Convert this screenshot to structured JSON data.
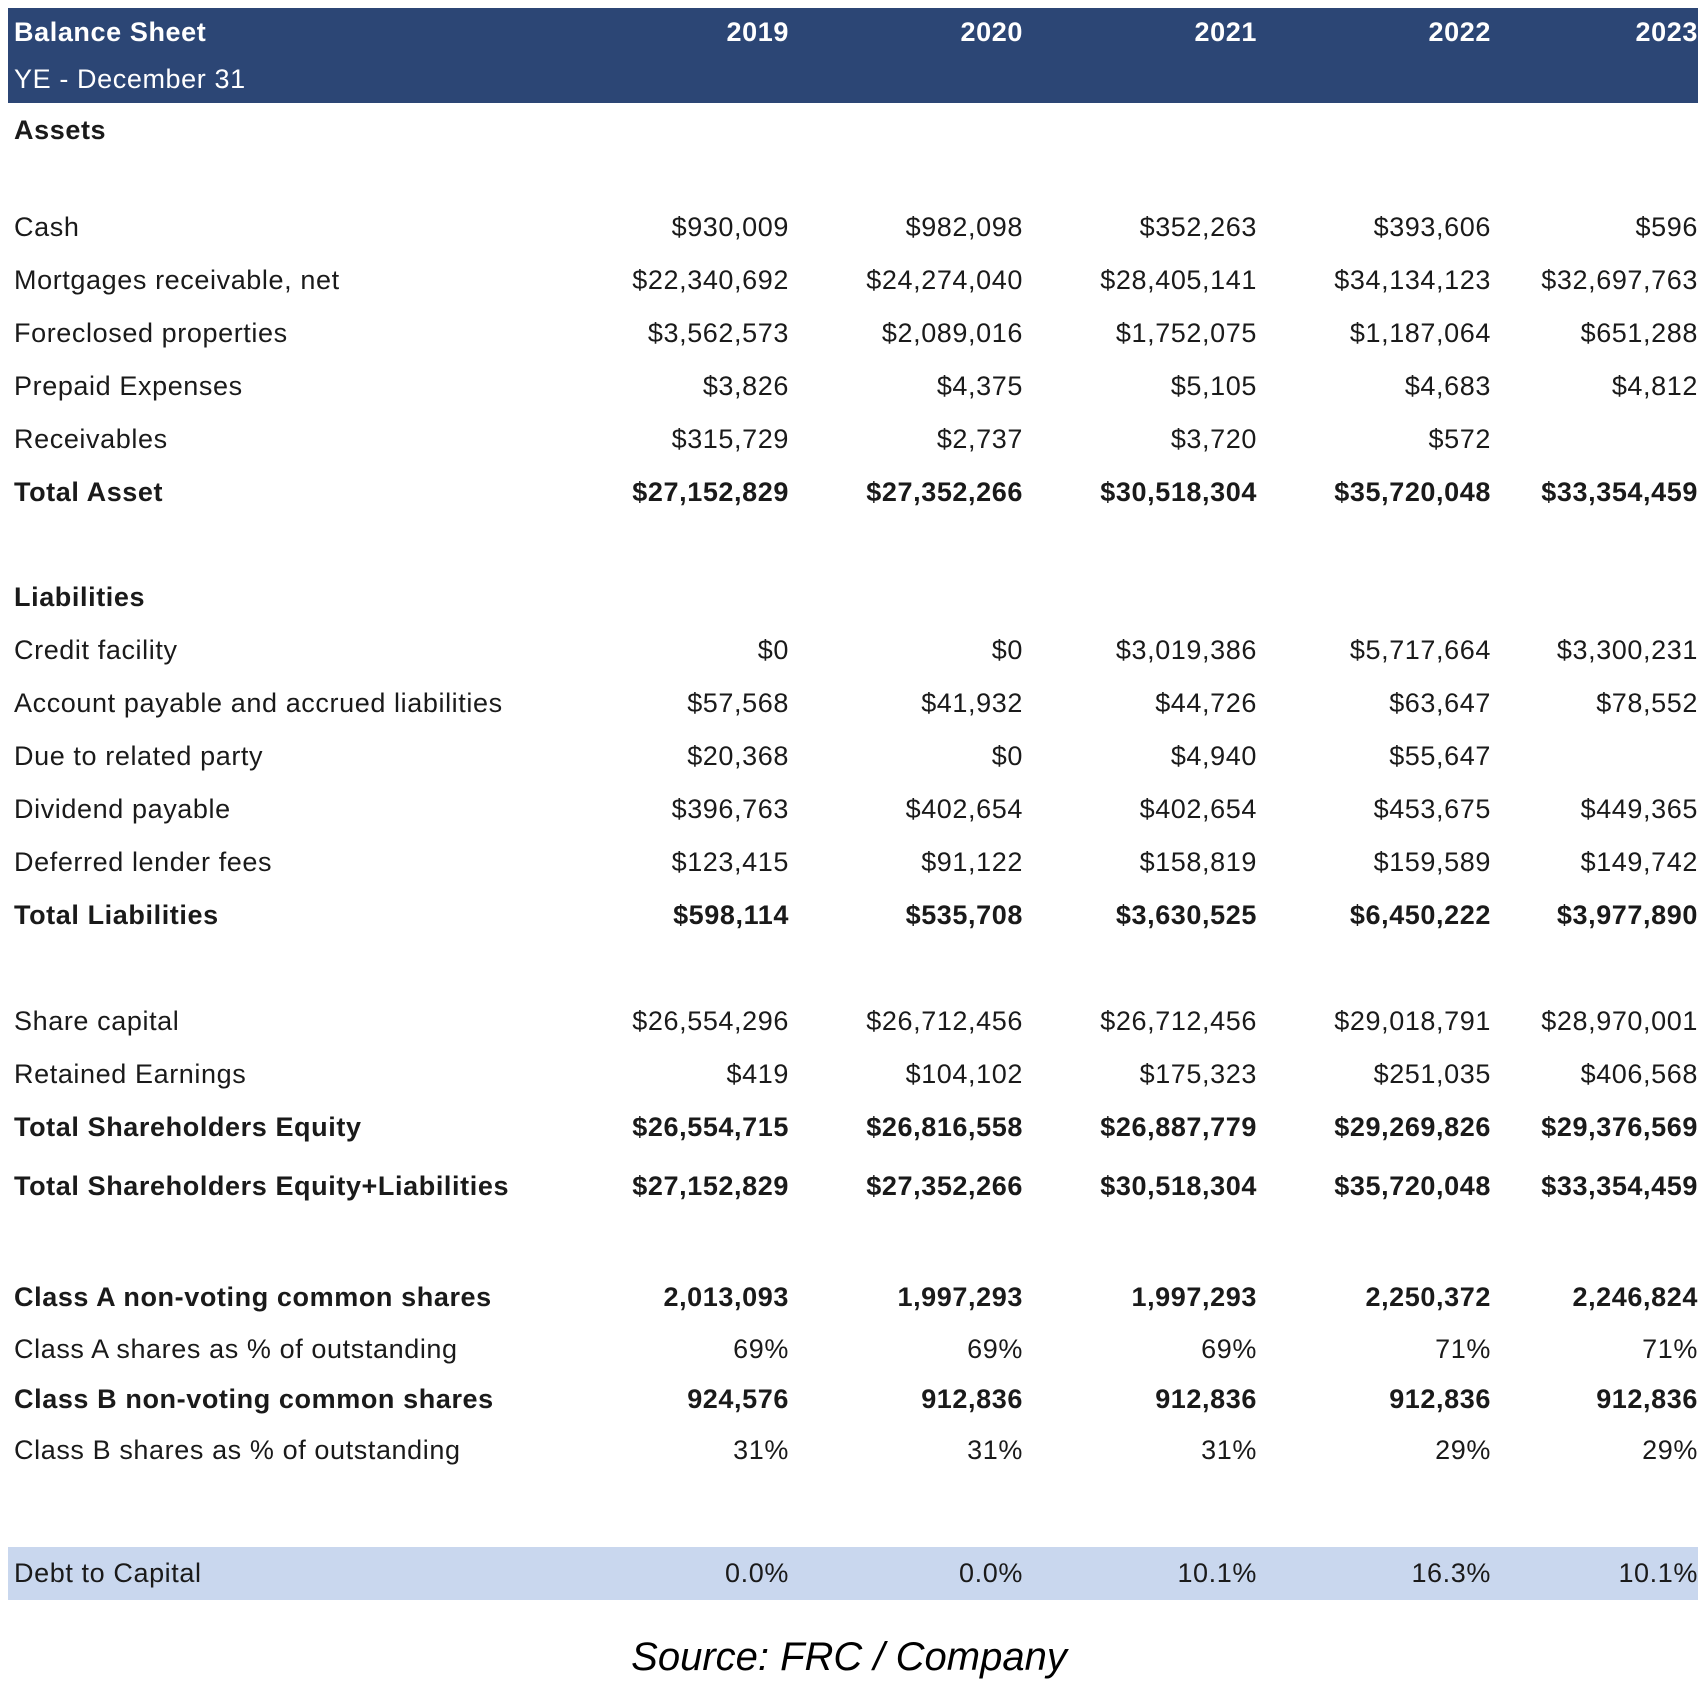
{
  "header": {
    "title": "Balance Sheet",
    "subtitle": "YE - December 31",
    "years": [
      "2019",
      "2020",
      "2021",
      "2022",
      "2023"
    ]
  },
  "colors": {
    "header_bg": "#2c4675",
    "header_text": "#ffffff",
    "highlight_bg": "#c9d7ee"
  },
  "sections": {
    "assets": {
      "heading": "Assets",
      "rows": [
        {
          "label": "Cash",
          "values": [
            "$930,009",
            "$982,098",
            "$352,263",
            "$393,606",
            "$596"
          ]
        },
        {
          "label": "Mortgages receivable, net",
          "values": [
            "$22,340,692",
            "$24,274,040",
            "$28,405,141",
            "$34,134,123",
            "$32,697,763"
          ]
        },
        {
          "label": "Foreclosed properties",
          "values": [
            "$3,562,573",
            "$2,089,016",
            "$1,752,075",
            "$1,187,064",
            "$651,288"
          ]
        },
        {
          "label": "Prepaid Expenses",
          "values": [
            "$3,826",
            "$4,375",
            "$5,105",
            "$4,683",
            "$4,812"
          ]
        },
        {
          "label": "Receivables",
          "values": [
            "$315,729",
            "$2,737",
            "$3,720",
            "$572",
            ""
          ]
        }
      ],
      "total": {
        "label": "Total Asset",
        "values": [
          "$27,152,829",
          "$27,352,266",
          "$30,518,304",
          "$35,720,048",
          "$33,354,459"
        ]
      }
    },
    "liabilities": {
      "heading": "Liabilities",
      "rows": [
        {
          "label": "Credit facility",
          "values": [
            "$0",
            "$0",
            "$3,019,386",
            "$5,717,664",
            "$3,300,231"
          ]
        },
        {
          "label": "Account payable and accrued liabilities",
          "values": [
            "$57,568",
            "$41,932",
            "$44,726",
            "$63,647",
            "$78,552"
          ]
        },
        {
          "label": "Due to related party",
          "values": [
            "$20,368",
            "$0",
            "$4,940",
            "$55,647",
            ""
          ]
        },
        {
          "label": "Dividend payable",
          "values": [
            "$396,763",
            "$402,654",
            "$402,654",
            "$453,675",
            "$449,365"
          ]
        },
        {
          "label": "Deferred lender fees",
          "values": [
            "$123,415",
            "$91,122",
            "$158,819",
            "$159,589",
            "$149,742"
          ]
        }
      ],
      "total": {
        "label": "Total Liabilities",
        "values": [
          "$598,114",
          "$535,708",
          "$3,630,525",
          "$6,450,222",
          "$3,977,890"
        ]
      }
    },
    "equity": {
      "rows": [
        {
          "label": "Share capital",
          "values": [
            "$26,554,296",
            "$26,712,456",
            "$26,712,456",
            "$29,018,791",
            "$28,970,001"
          ]
        },
        {
          "label": "Retained Earnings",
          "values": [
            "$419",
            "$104,102",
            "$175,323",
            "$251,035",
            "$406,568"
          ]
        }
      ],
      "total": {
        "label": "Total Shareholders Equity",
        "values": [
          "$26,554,715",
          "$26,816,558",
          "$26,887,779",
          "$29,269,826",
          "$29,376,569"
        ]
      },
      "grand_total": {
        "label": "Total Shareholders Equity+Liabilities",
        "values": [
          "$27,152,829",
          "$27,352,266",
          "$30,518,304",
          "$35,720,048",
          "$33,354,459"
        ]
      }
    },
    "shares": {
      "class_a": {
        "label": "Class A non-voting common shares",
        "values": [
          "2,013,093",
          "1,997,293",
          "1,997,293",
          "2,250,372",
          "2,246,824"
        ]
      },
      "class_a_pct": {
        "label": "Class A shares as % of outstanding",
        "values": [
          "69%",
          "69%",
          "69%",
          "71%",
          "71%"
        ]
      },
      "class_b": {
        "label": "Class B non-voting common shares",
        "values": [
          "924,576",
          "912,836",
          "912,836",
          "912,836",
          "912,836"
        ]
      },
      "class_b_pct": {
        "label": "Class B shares as % of outstanding",
        "values": [
          "31%",
          "31%",
          "31%",
          "29%",
          "29%"
        ]
      }
    },
    "ratios": {
      "debt_to_capital": {
        "label": "Debt to Capital",
        "values": [
          "0.0%",
          "0.0%",
          "10.1%",
          "16.3%",
          "10.1%"
        ]
      }
    }
  },
  "source": "Source: FRC / Company"
}
